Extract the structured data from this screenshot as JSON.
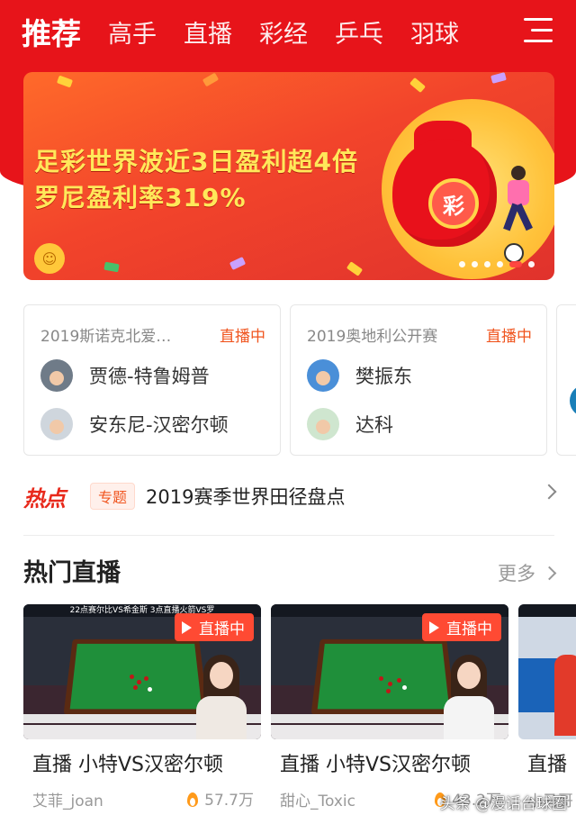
{
  "nav": {
    "tabs": [
      {
        "label": "推荐",
        "active": true
      },
      {
        "label": "高手"
      },
      {
        "label": "直播"
      },
      {
        "label": "彩经"
      },
      {
        "label": "乒乓"
      },
      {
        "label": "羽球"
      }
    ],
    "menu_icon": "hamburger-menu-icon"
  },
  "banner": {
    "line1": "足彩世界波近3日盈利超4倍",
    "line2": "罗尼盈利率319%",
    "bag_glyph": "彩",
    "dots_total": 6,
    "dots_active_index": 4
  },
  "matches": [
    {
      "title": "2019斯诺克北爱…",
      "status": "直播中",
      "players": [
        {
          "name": "贾德-特鲁姆普"
        },
        {
          "name": "安东尼-汉密尔顿"
        }
      ]
    },
    {
      "title": "2019奥地利公开赛",
      "status": "直播中",
      "players": [
        {
          "name": "樊振东"
        },
        {
          "name": "达科"
        }
      ]
    }
  ],
  "hot": {
    "logo": "热点",
    "tag": "专题",
    "title": "2019赛季世界田径盘点"
  },
  "hot_live": {
    "section_title": "热门直播",
    "more_label": "更多",
    "items": [
      {
        "badge": "直播中",
        "title": "直播 小特VS汉密尔顿",
        "anchor": "艾菲_joan",
        "heat": "57.7万",
        "overlay": "22点赛尔比VS希金斯 3点直播火箭VS罗"
      },
      {
        "badge": "直播中",
        "title": "直播 小特VS汉密尔顿",
        "anchor": "甜心_Toxic",
        "heat": "43.2万"
      },
      {
        "title": "直播",
        "anchor": "小马哥"
      }
    ]
  },
  "watermark": "头条 @漫话台球圈",
  "colors": {
    "brand_red": "#e7141a",
    "live_orange": "#f0551f",
    "banner_yellow": "#ffe85a"
  }
}
